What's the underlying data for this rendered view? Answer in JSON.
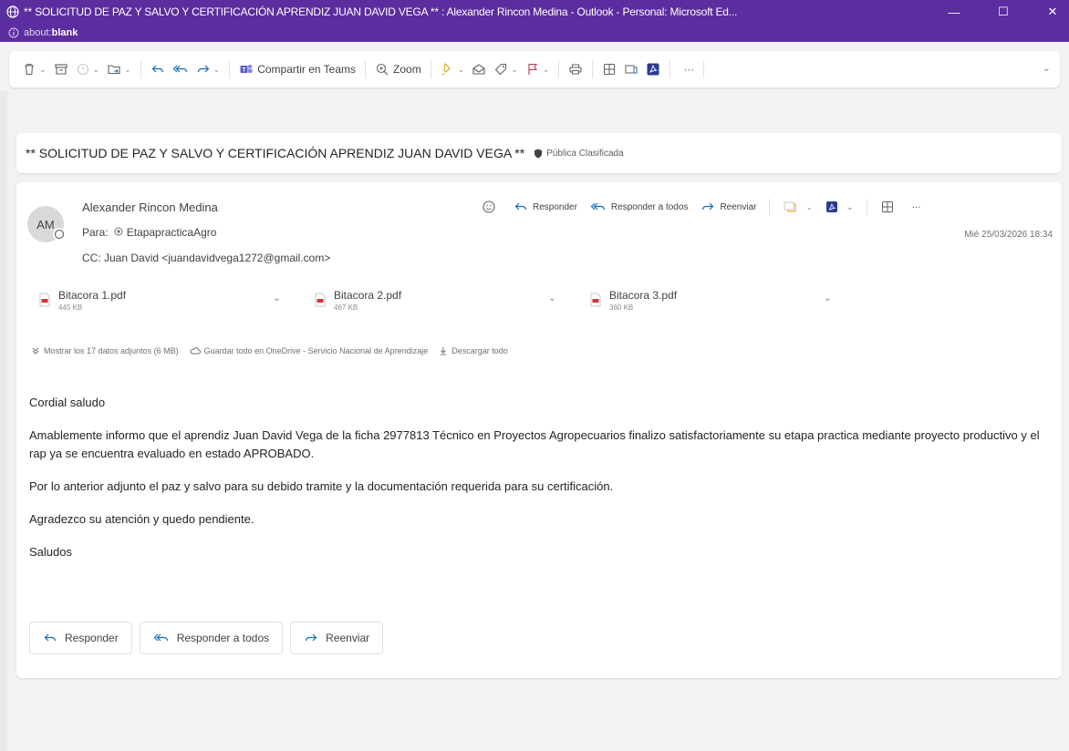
{
  "window": {
    "title": "** SOLICITUD DE PAZ Y SALVO Y CERTIFICACIÓN APRENDIZ JUAN DAVID VEGA ** : Alexander Rincon Medina - Outlook - Personal: Microsoft Ed...",
    "url_prefix": "about:",
    "url_main": "blank",
    "minimize": "—",
    "maximize": "☐",
    "close": "✕"
  },
  "toolbar": {
    "teams_label": "Compartir en Teams",
    "zoom_label": "Zoom",
    "more": "···"
  },
  "subject": {
    "text": "** SOLICITUD DE PAZ Y SALVO Y CERTIFICACIÓN APRENDIZ JUAN DAVID VEGA **",
    "sensitivity": "Pública Clasificada"
  },
  "message": {
    "avatar_initials": "AM",
    "sender": "Alexander Rincon Medina",
    "to_label": "Para:",
    "to": "EtapapracticaAgro",
    "cc": "CC: Juan David <juandavidvega1272@gmail.com>",
    "date": "Mié 25/03/2026 18:34",
    "actions": {
      "reply": "Responder",
      "reply_all": "Responder a todos",
      "forward": "Reenviar",
      "more": "···"
    }
  },
  "attachments": [
    {
      "name": "Bitacora 1.pdf",
      "size": "445 KB"
    },
    {
      "name": "Bitacora 2.pdf",
      "size": "467 KB"
    },
    {
      "name": "Bitacora 3.pdf",
      "size": "360 KB"
    }
  ],
  "attachment_links": {
    "show_all": "Mostrar los 17 datos adjuntos (6 MB)",
    "save_onedrive": "Guardar todo en OneDrive - Servicio Nacional de Aprendizaje",
    "download_all": "Descargar todo"
  },
  "body": {
    "greeting": "Cordial saludo",
    "p1": "Amablemente informo que el aprendiz Juan David Vega de la ficha 2977813 Técnico en Proyectos Agropecuarios finalizo satisfactoriamente su etapa practica mediante proyecto productivo y el rap ya se encuentra evaluado en estado APROBADO.",
    "p2": "Por lo anterior adjunto el paz y salvo para su debido tramite y la documentación requerida para su certificación.",
    "p3": "Agradezco su atención y quedo pendiente.",
    "closing": "Saludos"
  },
  "reply_buttons": {
    "reply": "Responder",
    "reply_all": "Responder a todos",
    "forward": "Reenviar"
  },
  "colors": {
    "titlebar": "#5b2d9e",
    "accent": "#0f6cbd",
    "pdf_red": "#d13438",
    "teams": "#5b5fc7"
  }
}
